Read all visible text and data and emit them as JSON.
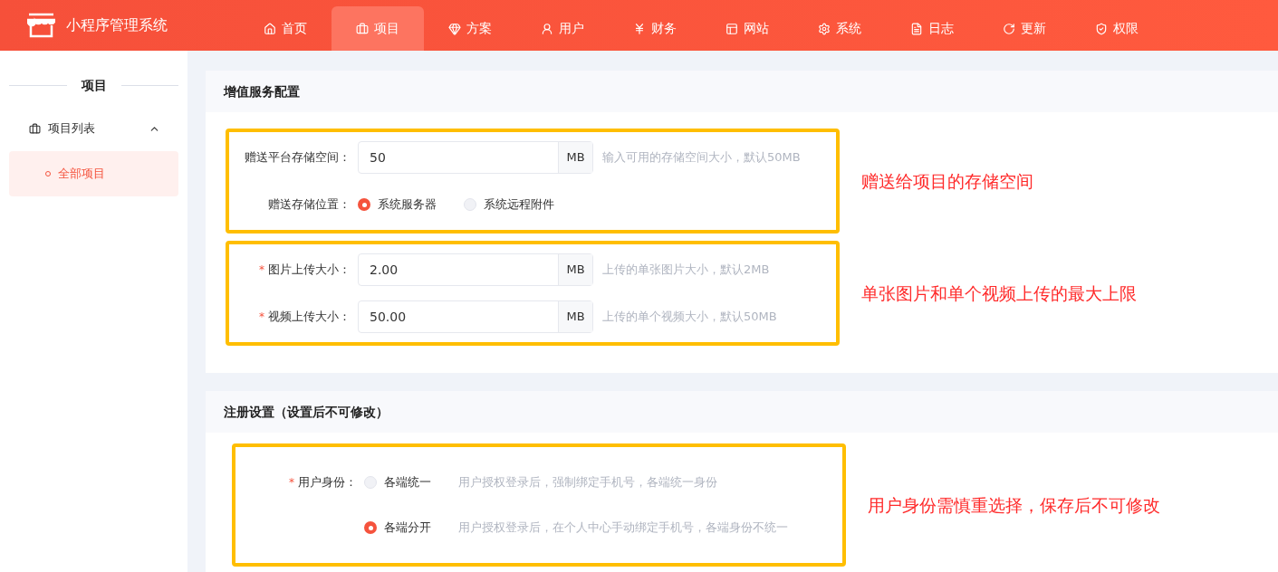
{
  "app": {
    "title": "小程序管理系统"
  },
  "nav": [
    {
      "label": "首页",
      "selected": false
    },
    {
      "label": "项目",
      "selected": true
    },
    {
      "label": "方案",
      "selected": false
    },
    {
      "label": "用户",
      "selected": false
    },
    {
      "label": "财务",
      "selected": false
    },
    {
      "label": "网站",
      "selected": false
    },
    {
      "label": "系统",
      "selected": false
    },
    {
      "label": "日志",
      "selected": false
    },
    {
      "label": "更新",
      "selected": false
    },
    {
      "label": "权限",
      "selected": false
    }
  ],
  "sidebar": {
    "title": "项目",
    "items": [
      {
        "label": "项目列表",
        "expanded": true,
        "children": [
          {
            "label": "全部项目",
            "selected": true
          }
        ]
      }
    ]
  },
  "sections": [
    {
      "title": "增值服务配置",
      "groups": [
        {
          "annotation": "赠送给项目的存储空间",
          "fields": [
            {
              "kind": "input",
              "label": "赠送平台存储空间：",
              "value": "50",
              "unit": "MB",
              "hint": "输入可用的存储空间大小，默认50MB"
            },
            {
              "kind": "radio",
              "label": "赠送存储位置：",
              "options": [
                {
                  "label": "系统服务器",
                  "selected": true
                },
                {
                  "label": "系统远程附件",
                  "selected": false
                }
              ]
            }
          ]
        },
        {
          "annotation": "单张图片和单个视频上传的最大上限",
          "fields": [
            {
              "kind": "input",
              "required_mark": "*",
              "label": "图片上传大小：",
              "value": "2.00",
              "unit": "MB",
              "hint": "上传的单张图片大小，默认2MB"
            },
            {
              "kind": "input",
              "required_mark": "*",
              "label": "视频上传大小：",
              "value": "50.00",
              "unit": "MB",
              "hint": "上传的单个视频大小，默认50MB"
            }
          ]
        }
      ]
    },
    {
      "title": "注册设置（设置后不可修改）",
      "groups": [
        {
          "annotation": "用户身份需慎重选择，保存后不可修改",
          "fields": [
            {
              "kind": "radio_list",
              "required_mark": "*",
              "label": "用户身份：",
              "options": [
                {
                  "label": "各端统一",
                  "selected": false,
                  "hint": "用户授权登录后，强制绑定手机号，各端统一身份"
                },
                {
                  "label": "各端分开",
                  "selected": true,
                  "hint": "用户授权登录后，在个人中心手动绑定手机号，各端身份不统一"
                }
              ]
            }
          ]
        }
      ]
    }
  ]
}
